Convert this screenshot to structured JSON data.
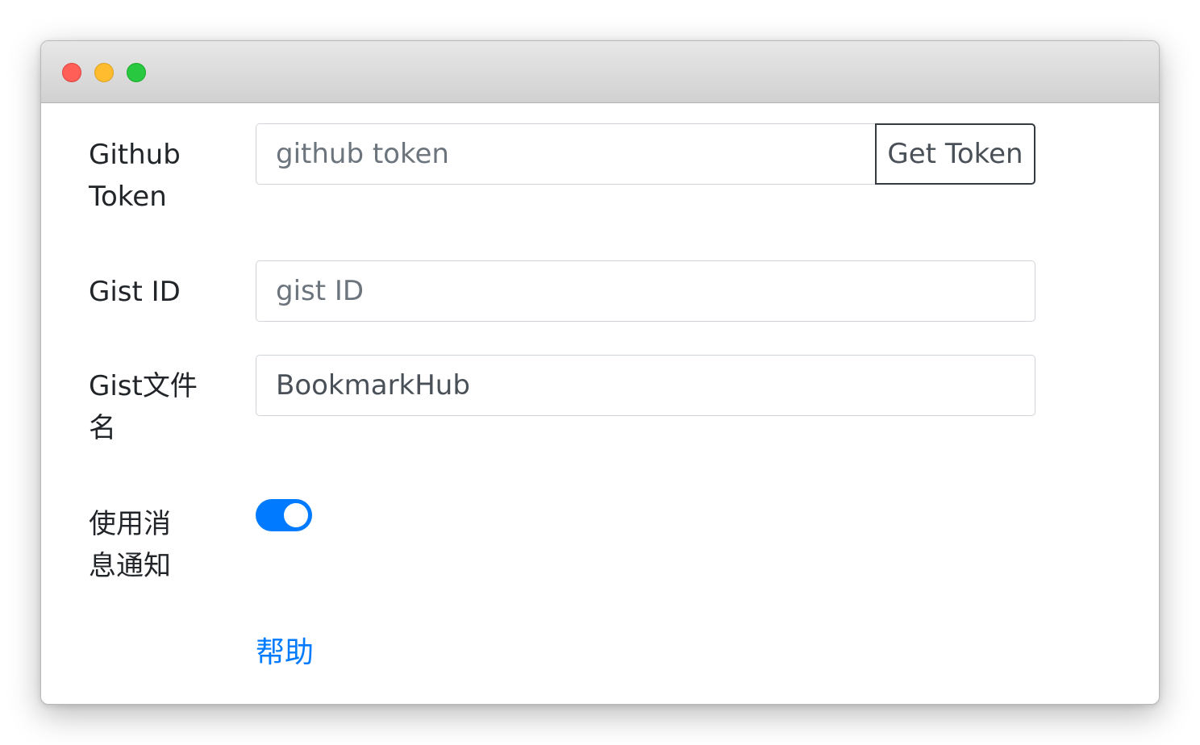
{
  "window": {
    "controls": [
      "close",
      "minimize",
      "maximize"
    ]
  },
  "form": {
    "github_token": {
      "label": "Github Token",
      "placeholder": "github token",
      "value": "",
      "button_label": "Get Token"
    },
    "gist_id": {
      "label": "Gist ID",
      "placeholder": "gist ID",
      "value": ""
    },
    "gist_filename": {
      "label": "Gist文件名",
      "value": "BookmarkHub"
    },
    "notifications": {
      "label": "使用消息通知",
      "enabled": true
    },
    "help_link": "帮助"
  },
  "colors": {
    "accent": "#007bff",
    "text": "#212529",
    "input_border": "#ced4da",
    "button_border": "#343a40"
  }
}
